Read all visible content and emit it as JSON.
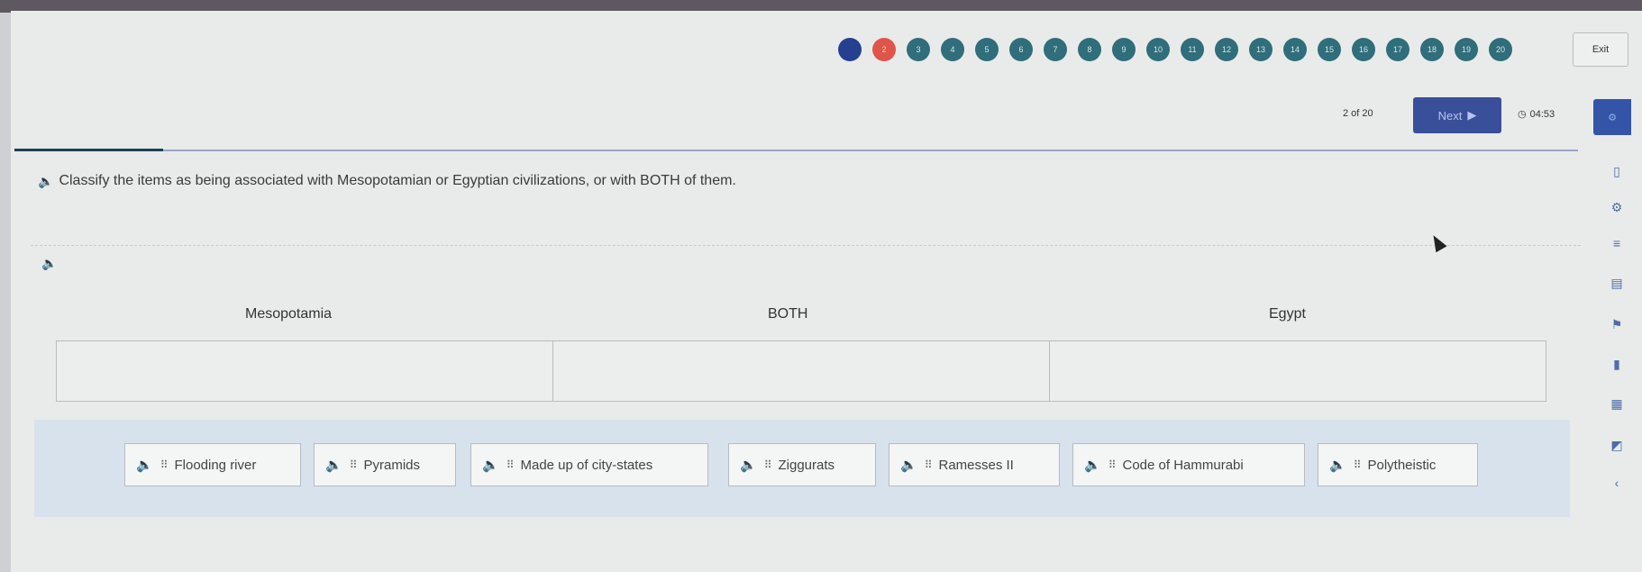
{
  "header": {
    "progress_dots": [
      {
        "label": "1",
        "state": "done"
      },
      {
        "label": "2",
        "state": "current"
      },
      {
        "label": "3",
        "state": "todo"
      },
      {
        "label": "4",
        "state": "todo"
      },
      {
        "label": "5",
        "state": "todo"
      },
      {
        "label": "6",
        "state": "todo"
      },
      {
        "label": "7",
        "state": "todo"
      },
      {
        "label": "8",
        "state": "todo"
      },
      {
        "label": "9",
        "state": "todo"
      },
      {
        "label": "10",
        "state": "todo"
      },
      {
        "label": "11",
        "state": "todo"
      },
      {
        "label": "12",
        "state": "todo"
      },
      {
        "label": "13",
        "state": "todo"
      },
      {
        "label": "14",
        "state": "todo"
      },
      {
        "label": "15",
        "state": "todo"
      },
      {
        "label": "16",
        "state": "todo"
      },
      {
        "label": "17",
        "state": "todo"
      },
      {
        "label": "18",
        "state": "todo"
      },
      {
        "label": "19",
        "state": "todo"
      },
      {
        "label": "20",
        "state": "todo"
      }
    ],
    "exit_label": "Exit",
    "counter": "2 of 20",
    "next_label": "Next",
    "timer": "04:53"
  },
  "question": {
    "prompt": "Classify the items as being associated with Mesopotamian or Egyptian civilizations, or with BOTH of them."
  },
  "columns": [
    "Mesopotamia",
    "BOTH",
    "Egypt"
  ],
  "items": [
    {
      "label": "Flooding river"
    },
    {
      "label": "Pyramids"
    },
    {
      "label": "Made up of city-states"
    },
    {
      "label": "Ziggurats"
    },
    {
      "label": "Ramesses II"
    },
    {
      "label": "Code of Hammurabi"
    },
    {
      "label": "Polytheistic"
    }
  ],
  "icons": {
    "speaker": "speaker-icon",
    "grip": "drag-handle-icon",
    "clock": "clock-icon",
    "next_arrow": "play-arrow-icon"
  },
  "colors": {
    "done_dot": "#25408f",
    "current_dot": "#e0554a",
    "todo_dot": "#2f6e7a",
    "next_button": "#3a4f9a",
    "tray": "#d7e2ec"
  }
}
